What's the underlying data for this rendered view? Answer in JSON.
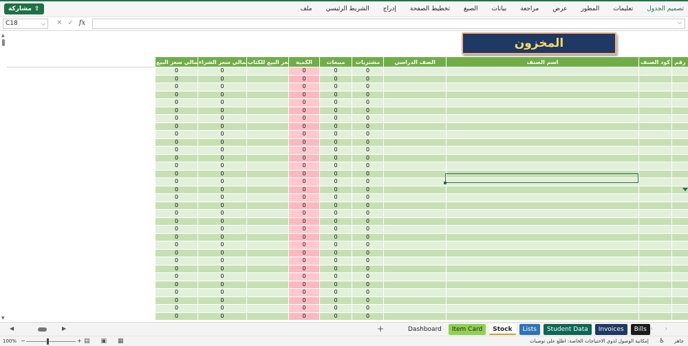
{
  "ribbon": {
    "share_label": "مشاركة",
    "tabs": [
      "ملف",
      "الشريط الرئيسي",
      "إدراج",
      "تخطيط الصفحة",
      "الصيغ",
      "بيانات",
      "مراجعة",
      "عرض",
      "المطور",
      "تعليمات",
      "تصميم الجدول"
    ],
    "active_tab": "تصميم الجدول"
  },
  "formula_bar": {
    "name_box": "C18",
    "fx": "fx",
    "formula": ""
  },
  "sheet": {
    "title": "المخزون",
    "columns": [
      "اجمالي سعر البيع",
      "اجمالي سعر الشراء",
      "سعر البيع للكتاب",
      "الكمية",
      "مبيعات",
      "مشتريات",
      "الصف الدراسي",
      "اسم الصنف",
      "كود الصنف",
      "رقم"
    ],
    "row_values": [
      "0",
      "0",
      "",
      "0",
      "0",
      "0",
      "",
      "",
      "",
      ""
    ],
    "row_count": 32
  },
  "sheet_tabs": [
    {
      "label": "Dashboard",
      "style": "plain"
    },
    {
      "label": "Item Card",
      "style": "green"
    },
    {
      "label": "Stock",
      "style": "active"
    },
    {
      "label": "Lists",
      "style": "teal"
    },
    {
      "label": "Student Data",
      "style": "dteal"
    },
    {
      "label": "Invoices",
      "style": "navy"
    },
    {
      "label": "Bills",
      "style": "black"
    }
  ],
  "status": {
    "zoom": "100%",
    "accessibility": "إمكانية الوصول لذوي الاحتياجات الخاصة: اطلع على توصيات",
    "ready": "جاهز"
  },
  "colors": {
    "header_green": "#70ad47",
    "row_light": "#e2efda",
    "row_dark": "#c6e0b4",
    "qty_pink": "#ffc7ce",
    "title_bg": "#1f3864",
    "title_text": "#ffd966"
  }
}
